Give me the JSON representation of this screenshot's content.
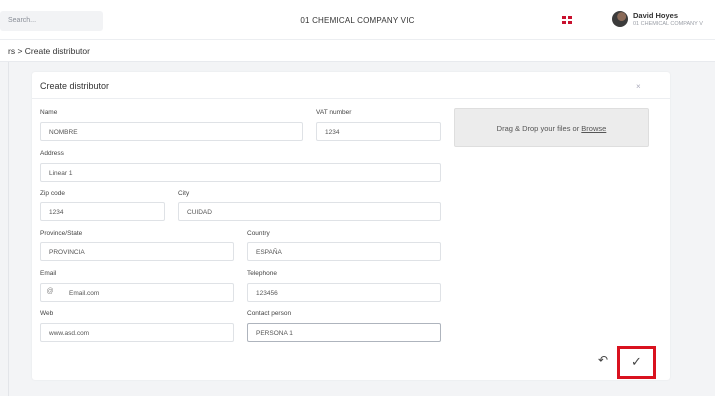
{
  "header": {
    "search_placeholder": "Search...",
    "company": "01 CHEMICAL COMPANY VIC",
    "user_name": "David Hoyes",
    "user_company": "01 CHEMICAL COMPANY V"
  },
  "breadcrumb": "rs > Create distributor",
  "modal": {
    "title": "Create distributor",
    "close": "×"
  },
  "form": {
    "name": {
      "label": "Name",
      "value": "NOMBRE"
    },
    "vat": {
      "label": "VAT number",
      "value": "1234"
    },
    "address": {
      "label": "Address",
      "value": "Linear 1"
    },
    "zip": {
      "label": "Zip code",
      "value": "1234"
    },
    "city": {
      "label": "City",
      "value": "CUIDAD"
    },
    "province": {
      "label": "Province/State",
      "value": "PROVINCIA"
    },
    "country": {
      "label": "Country",
      "value": "ESPAÑA"
    },
    "email": {
      "label": "Email",
      "prefix": "@",
      "value": "Email.com"
    },
    "telephone": {
      "label": "Telephone",
      "value": "123456"
    },
    "web": {
      "label": "Web",
      "value": "www.asd.com"
    },
    "contact": {
      "label": "Contact person",
      "value": "PERSONA 1"
    }
  },
  "dropzone": {
    "text": "Drag & Drop your files or ",
    "link": "Browse"
  },
  "actions": {
    "back_icon": "↶",
    "confirm_icon": "✓"
  },
  "colors": {
    "highlight": "#d9121f",
    "background": "#f3f4f6"
  }
}
